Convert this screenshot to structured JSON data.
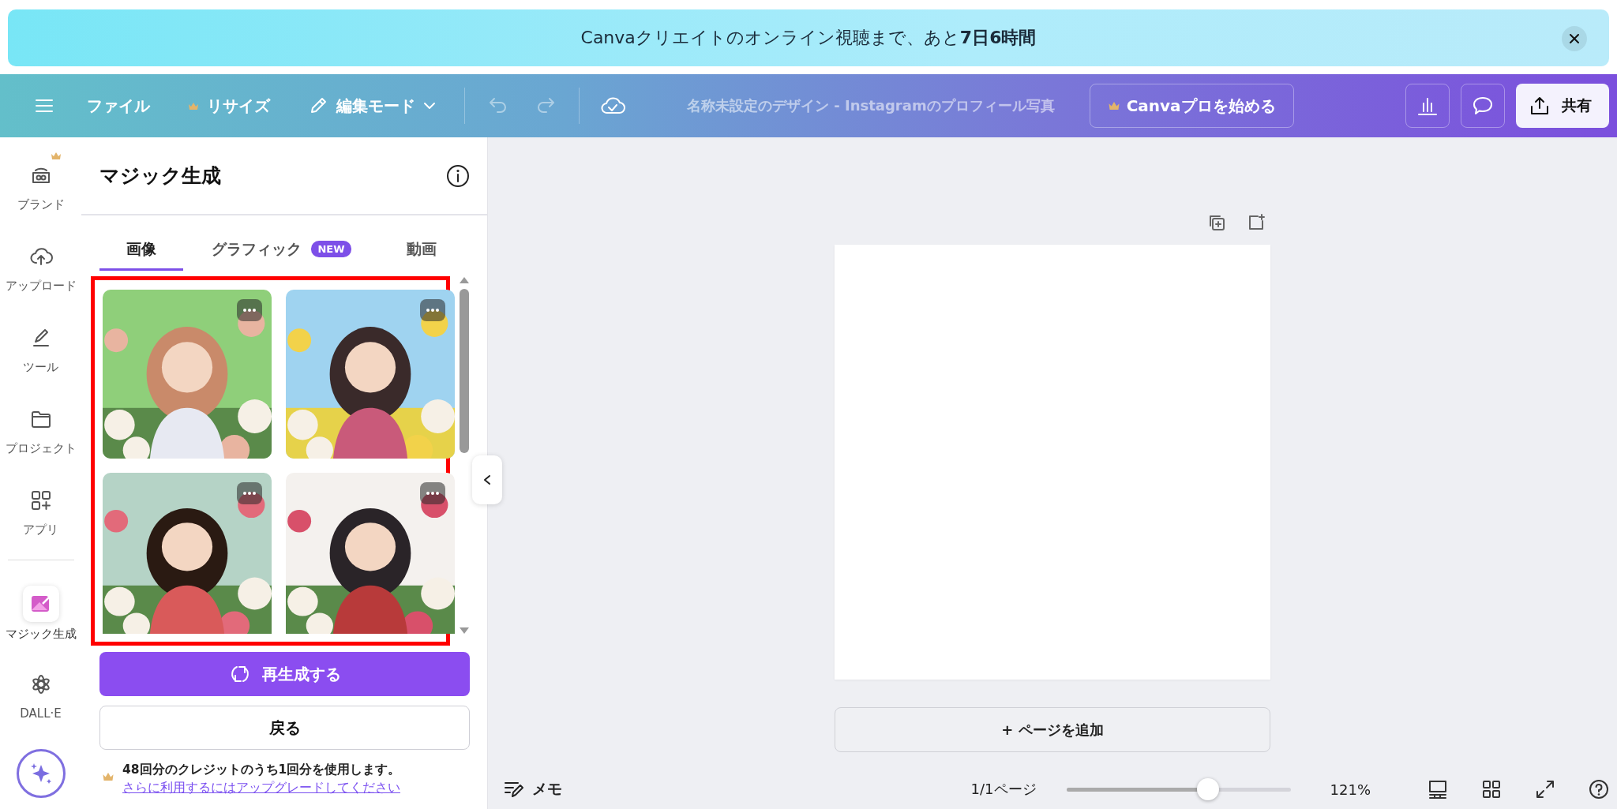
{
  "banner": {
    "text": "Canvaクリエイトのオンライン視聴まで、あと**7日6時間**"
  },
  "toolbar": {
    "menu_items": [
      {
        "label": "ファイル",
        "pro": false
      },
      {
        "label": "リサイズ",
        "pro": true
      }
    ],
    "mode": {
      "label": "編集モード"
    },
    "undo": {
      "disabled": true
    },
    "redo": {
      "disabled": true
    },
    "title": "名称未設定のデザイン - Instagramのプロフィール写真",
    "pro_button": "Canvaプロを始める",
    "share_button": "共有"
  },
  "sidebar": {
    "items": [
      {
        "label": "ブランド",
        "selected": false,
        "pro": true
      },
      {
        "label": "アップロード",
        "selected": false,
        "pro": false
      },
      {
        "label": "ツール",
        "selected": false,
        "pro": false
      },
      {
        "label": "プロジェクト",
        "selected": false,
        "pro": false
      },
      {
        "label": "アプリ",
        "selected": false,
        "pro": false
      },
      {
        "label": "マジック生成",
        "selected": true,
        "pro": false
      },
      {
        "label": "DALL·E",
        "selected": false,
        "pro": false
      }
    ]
  },
  "panel": {
    "title": "マジック生成",
    "tabs": [
      {
        "label": "画像",
        "selected": true
      },
      {
        "label": "グラフィック",
        "selected": false,
        "badge": "NEW"
      },
      {
        "label": "動画",
        "selected": false
      }
    ],
    "regenerate_button": "再生成する",
    "back_button": "戻る",
    "credit_note": "48回分のクレジットのうち1回分を使用します。",
    "upgrade_link": "さらに利用するにはアップグレードしてください"
  },
  "canvas": {
    "add_page_button": "+ ページを追加"
  },
  "status_bar": {
    "notes": "メモ",
    "page": "1/1ページ",
    "zoom": {
      "level": 0.62
    },
    "zoom_reading": "121%"
  }
}
